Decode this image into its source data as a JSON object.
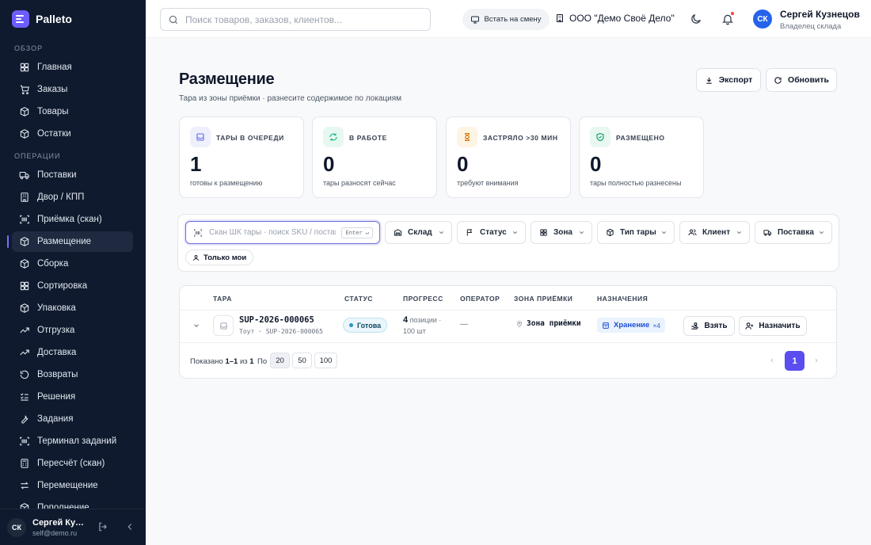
{
  "app": {
    "name": "Palleto"
  },
  "sidebar": {
    "sections": [
      {
        "label": "ОБЗОР",
        "items": [
          {
            "label": "Главная",
            "icon": "grid-icon"
          },
          {
            "label": "Заказы",
            "icon": "cart-icon"
          },
          {
            "label": "Товары",
            "icon": "box-icon"
          },
          {
            "label": "Остатки",
            "icon": "box-icon"
          }
        ]
      },
      {
        "label": "ОПЕРАЦИИ",
        "items": [
          {
            "label": "Поставки",
            "icon": "truck-icon"
          },
          {
            "label": "Двор / КПП",
            "icon": "building-icon"
          },
          {
            "label": "Приёмка (скан)",
            "icon": "scan-icon"
          },
          {
            "label": "Размещение",
            "icon": "box-icon",
            "active": true
          },
          {
            "label": "Сборка",
            "icon": "box-icon"
          },
          {
            "label": "Сортировка",
            "icon": "grid-icon"
          },
          {
            "label": "Упаковка",
            "icon": "box-icon"
          },
          {
            "label": "Отгрузка",
            "icon": "trend-icon"
          },
          {
            "label": "Доставка",
            "icon": "trend-icon"
          },
          {
            "label": "Возвраты",
            "icon": "rotate-icon"
          },
          {
            "label": "Решения",
            "icon": "list-check-icon"
          },
          {
            "label": "Задания",
            "icon": "wrench-icon"
          },
          {
            "label": "Терминал заданий",
            "icon": "scan-icon"
          },
          {
            "label": "Пересчёт (скан)",
            "icon": "calculator-icon"
          },
          {
            "label": "Перемещение",
            "icon": "arrows-icon"
          },
          {
            "label": "Пополнение",
            "icon": "box-icon"
          }
        ]
      }
    ],
    "user": {
      "initials": "СК",
      "name": "Сергей Кузнецов",
      "email": "self@demo.ru"
    }
  },
  "topbar": {
    "search_placeholder": "Поиск товаров, заказов, клиентов...",
    "shift_label": "Встать на смену",
    "org_name": "ООО \"Демо Своё Дело\"",
    "user": {
      "initials": "СК",
      "name": "Сергей Кузнецов",
      "role": "Владелец склада"
    }
  },
  "page": {
    "title": "Размещение",
    "subtitle": "Тара из зоны приёмки · разнесите содержимое по локациям",
    "export_label": "Экспорт",
    "refresh_label": "Обновить"
  },
  "stats": [
    {
      "label": "ТАРЫ В ОЧЕРЕДИ",
      "value": "1",
      "desc": "готовы к размещению",
      "icon": "inbox-icon",
      "accent": "#6366f1",
      "bg": "#eef0fb"
    },
    {
      "label": "В РАБОТЕ",
      "value": "0",
      "desc": "тары разносят сейчас",
      "icon": "refresh-icon",
      "accent": "#10b981",
      "bg": "#e7f8f1"
    },
    {
      "label": "ЗАСТРЯЛО >30 МИН",
      "value": "0",
      "desc": "требуют внимания",
      "icon": "hourglass-icon",
      "accent": "#d97706",
      "bg": "#fdf4e4"
    },
    {
      "label": "РАЗМЕЩЕНО",
      "value": "0",
      "desc": "тары полностью разнесены",
      "icon": "shield-check-icon",
      "accent": "#059669",
      "bg": "#e8f7f0"
    }
  ],
  "filters": {
    "scan_placeholder": "Скан ШК тары · поиск SKU / поставщика",
    "scan_key": "Enter ↵",
    "selects": [
      {
        "label": "Склад",
        "icon": "warehouse-icon"
      },
      {
        "label": "Статус",
        "icon": "flag-icon"
      },
      {
        "label": "Зона",
        "icon": "grid-icon"
      },
      {
        "label": "Тип тары",
        "icon": "box-icon"
      },
      {
        "label": "Клиент",
        "icon": "users-icon"
      },
      {
        "label": "Поставка",
        "icon": "truck-icon"
      }
    ],
    "only_mine_label": "Только мои"
  },
  "table": {
    "headers": [
      "ТАРА",
      "СТАТУС",
      "ПРОГРЕСС",
      "ОПЕРАТОР",
      "ЗОНА ПРИЁМКИ",
      "НАЗНАЧЕНИЯ"
    ],
    "rows": [
      {
        "code": "SUP-2026-000065",
        "sub": "Тоут · SUP-2026-000065",
        "status": "Готова",
        "positions": "4",
        "positions_unit": "позиции ·",
        "qty": "100 шт",
        "operator": "—",
        "zone": "Зона приёмки",
        "assignment": "Хранение",
        "assignment_count": "×4",
        "take_label": "Взять",
        "assign_label": "Назначить"
      }
    ]
  },
  "pagination": {
    "shown_prefix": "Показано",
    "shown_range": "1–1",
    "shown_of": "из",
    "total": "1",
    "by_label": "По",
    "sizes": [
      "20",
      "50",
      "100"
    ],
    "current_page": "1"
  }
}
